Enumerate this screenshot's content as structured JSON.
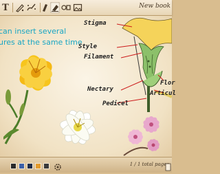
{
  "toolbar": {
    "tools": [
      {
        "name": "text-tool",
        "label": "T"
      },
      {
        "name": "pen-tool",
        "label": ""
      },
      {
        "name": "brush-tool",
        "label": ""
      },
      {
        "name": "marker-tool",
        "label": ""
      },
      {
        "name": "eraser-tool",
        "label": ""
      },
      {
        "name": "shape-tool",
        "label": ""
      },
      {
        "name": "image-tool",
        "label": ""
      }
    ],
    "book_title": "New book"
  },
  "canvas": {
    "note_lines": [
      "can insert several",
      "ures at the same time"
    ],
    "diagram_labels": {
      "stigma": "Stigma",
      "style": "Style",
      "filament": "Filament",
      "nectary": "Nectary",
      "pedicel": "Pedicel",
      "flower": "Flor",
      "articulation": "Articul"
    },
    "images": [
      "yellow-lily-image",
      "white-lily-image",
      "pink-blossom-image",
      "flower-cross-section-diagram"
    ]
  },
  "bottombar": {
    "colors": [
      "#2a2a2a",
      "#3b5fa8",
      "#1f2e4a",
      "#e39a2b",
      "#3a3a3a"
    ],
    "page_indicator": "1 / 1 total pages"
  }
}
